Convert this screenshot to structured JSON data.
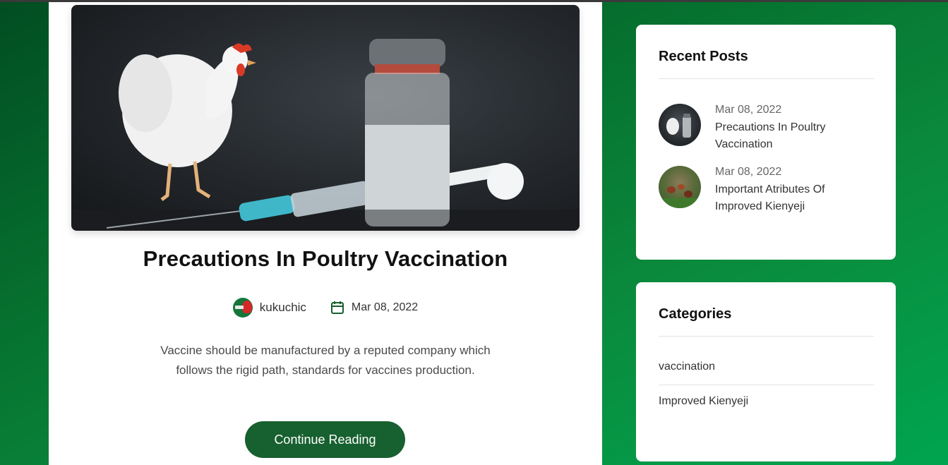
{
  "post": {
    "title": "Precautions In Poultry Vaccination",
    "author": "kukuchic",
    "date": "Mar 08, 2022",
    "excerpt": "Vaccine should be manufactured by a reputed company which follows the rigid path, standards for vaccines production.",
    "continue_label": "Continue Reading",
    "image_icon": "chicken-vaccine-photo"
  },
  "recent_posts": {
    "title": "Recent Posts",
    "items": [
      {
        "date": "Mar 08, 2022",
        "title": "Precautions In Poultry Vaccination"
      },
      {
        "date": "Mar 08, 2022",
        "title": "Important Atributes Of Improved Kienyeji"
      }
    ]
  },
  "categories": {
    "title": "Categories",
    "items": [
      "vaccination",
      "Improved Kienyeji"
    ]
  },
  "colors": {
    "accent": "#17602f",
    "background_green": "#0a8a3c",
    "card": "#ffffff"
  }
}
